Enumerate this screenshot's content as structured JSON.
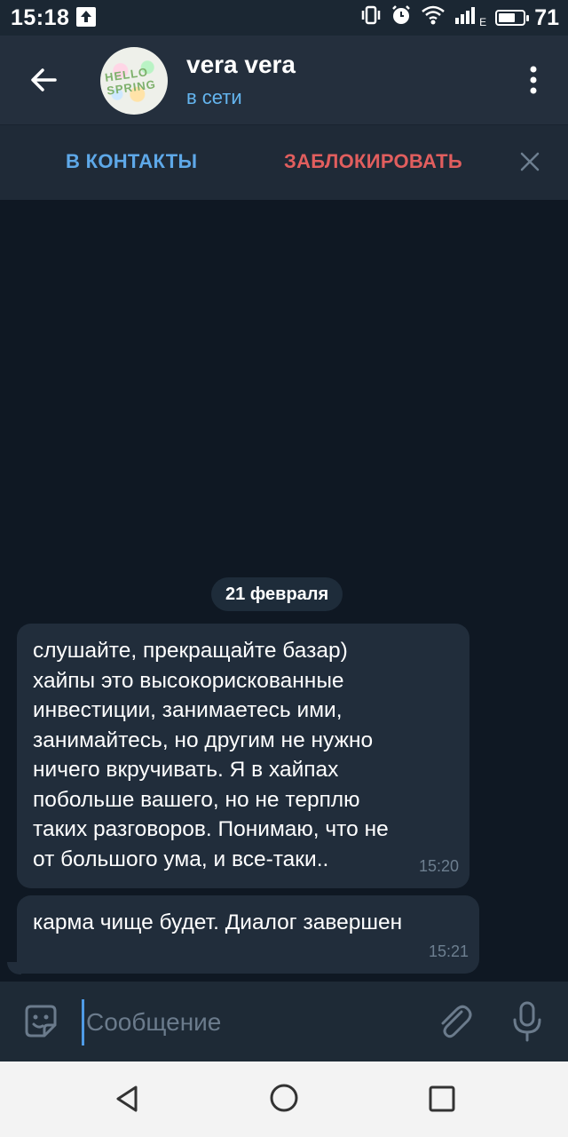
{
  "status_bar": {
    "time": "15:18",
    "network_type": "E",
    "battery_percent": "71",
    "battery_level": 0.71
  },
  "header": {
    "name": "vera vera",
    "status": "в сети",
    "avatar_text": "HELLO SPRING",
    "icons": [
      "arrow-left-icon",
      "more-vertical-icon"
    ]
  },
  "action_bar": {
    "add_contact_label": "В КОНТАКТЫ",
    "block_label": "ЗАБЛОКИРОВАТЬ"
  },
  "chat": {
    "date_label": "21 февраля",
    "messages": [
      {
        "text": "слушайте, прекращайте базар)\nхайпы это высокорискованные\nинвестиции, занимаетесь ими,\nзанимайтесь, но другим не нужно\nничего вкручивать. Я в хайпах\nпобольше вашего, но не терплю\nтаких разговоров. Понимаю, что не\nот большого ума, и все-таки..",
        "time": "15:20"
      },
      {
        "text": "карма чище будет. Диалог завершен",
        "time": "15:21"
      }
    ]
  },
  "input_bar": {
    "placeholder": "Сообщение",
    "value": ""
  },
  "colors": {
    "background": "#0f1823",
    "header": "#242f3d",
    "accent": "#5ea8e8",
    "danger": "#e15e5e",
    "bubble": "#212d3b"
  }
}
